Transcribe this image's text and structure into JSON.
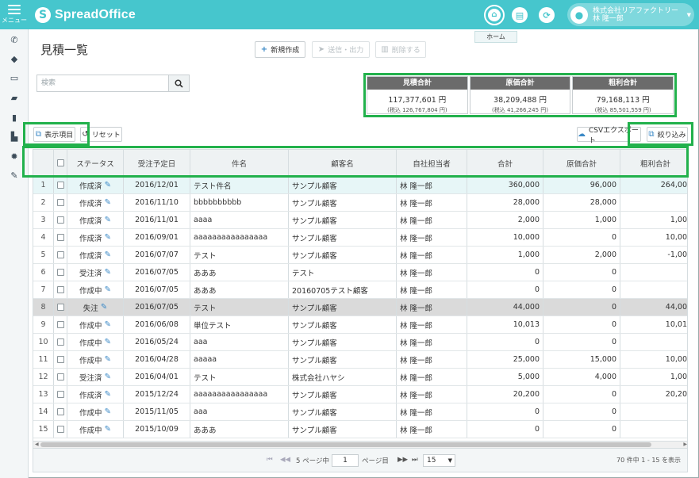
{
  "app": {
    "logo_text": "SpreadOffice",
    "menu_label": "メニュー",
    "home_tooltip": "ホーム",
    "user_company": "株式会社リアファクトリー",
    "user_name": "林 隆一郎"
  },
  "page": {
    "title": "見積一覧"
  },
  "toolbar": {
    "new_label": "新規作成",
    "send_label": "送信・出力",
    "delete_label": "削除する"
  },
  "search": {
    "placeholder": "検索"
  },
  "totals": [
    {
      "label": "見積合計",
      "value": "117,377,601 円",
      "sub": "(税込 126,767,804 円)"
    },
    {
      "label": "原価合計",
      "value": "38,209,488 円",
      "sub": "(税込 41,266,245 円)"
    },
    {
      "label": "粗利合計",
      "value": "79,168,113 円",
      "sub": "(税込 85,501,559 円)"
    }
  ],
  "controls": {
    "display_items_label": "表示項目",
    "reset_label": "リセット",
    "csv_label": "CSVエクスポート",
    "filter_label": "絞り込み"
  },
  "table": {
    "headers": [
      "ステータス",
      "受注予定日",
      "件名",
      "顧客名",
      "自社担当者",
      "合計",
      "原価合計",
      "粗利合計"
    ],
    "rows": [
      {
        "no": "1",
        "status": "作成済",
        "date": "2016/12/01",
        "subject": "テスト件名",
        "customer": "サンプル顧客",
        "staff": "林 隆一郎",
        "total": "360,000",
        "cost": "96,000",
        "profit": "264,00"
      },
      {
        "no": "2",
        "status": "作成済",
        "date": "2016/11/10",
        "subject": "bbbbbbbbbb",
        "customer": "サンプル顧客",
        "staff": "林 隆一郎",
        "total": "28,000",
        "cost": "28,000",
        "profit": ""
      },
      {
        "no": "3",
        "status": "作成済",
        "date": "2016/11/01",
        "subject": "aaaa",
        "customer": "サンプル顧客",
        "staff": "林 隆一郎",
        "total": "2,000",
        "cost": "1,000",
        "profit": "1,00"
      },
      {
        "no": "4",
        "status": "作成済",
        "date": "2016/09/01",
        "subject": "aaaaaaaaaaaaaaaa",
        "customer": "サンプル顧客",
        "staff": "林 隆一郎",
        "total": "10,000",
        "cost": "0",
        "profit": "10,00"
      },
      {
        "no": "5",
        "status": "作成済",
        "date": "2016/07/07",
        "subject": "テスト",
        "customer": "サンプル顧客",
        "staff": "林 隆一郎",
        "total": "1,000",
        "cost": "2,000",
        "profit": "-1,00"
      },
      {
        "no": "6",
        "status": "受注済",
        "date": "2016/07/05",
        "subject": "あああ",
        "customer": "テスト",
        "staff": "林 隆一郎",
        "total": "0",
        "cost": "0",
        "profit": ""
      },
      {
        "no": "7",
        "status": "作成中",
        "date": "2016/07/05",
        "subject": "あああ",
        "customer": "20160705テスト顧客",
        "staff": "林 隆一郎",
        "total": "0",
        "cost": "0",
        "profit": ""
      },
      {
        "no": "8",
        "status": "失注",
        "date": "2016/07/05",
        "subject": "テスト",
        "customer": "サンプル顧客",
        "staff": "林 隆一郎",
        "total": "44,000",
        "cost": "0",
        "profit": "44,00"
      },
      {
        "no": "9",
        "status": "作成中",
        "date": "2016/06/08",
        "subject": "単位テスト",
        "customer": "サンプル顧客",
        "staff": "林 隆一郎",
        "total": "10,013",
        "cost": "0",
        "profit": "10,01"
      },
      {
        "no": "10",
        "status": "作成中",
        "date": "2016/05/24",
        "subject": "aaa",
        "customer": "サンプル顧客",
        "staff": "林 隆一郎",
        "total": "0",
        "cost": "0",
        "profit": ""
      },
      {
        "no": "11",
        "status": "作成中",
        "date": "2016/04/28",
        "subject": "aaaaa",
        "customer": "サンプル顧客",
        "staff": "林 隆一郎",
        "total": "25,000",
        "cost": "15,000",
        "profit": "10,00"
      },
      {
        "no": "12",
        "status": "受注済",
        "date": "2016/04/01",
        "subject": "テスト",
        "customer": "株式会社ハヤシ",
        "staff": "林 隆一郎",
        "total": "5,000",
        "cost": "4,000",
        "profit": "1,00"
      },
      {
        "no": "13",
        "status": "作成済",
        "date": "2015/12/24",
        "subject": "aaaaaaaaaaaaaaaa",
        "customer": "サンプル顧客",
        "staff": "林 隆一郎",
        "total": "20,200",
        "cost": "0",
        "profit": "20,20"
      },
      {
        "no": "14",
        "status": "作成中",
        "date": "2015/11/05",
        "subject": "aaa",
        "customer": "サンプル顧客",
        "staff": "林 隆一郎",
        "total": "0",
        "cost": "0",
        "profit": ""
      },
      {
        "no": "15",
        "status": "作成中",
        "date": "2015/10/09",
        "subject": "あああ",
        "customer": "サンプル顧客",
        "staff": "林 隆一郎",
        "total": "0",
        "cost": "0",
        "profit": ""
      }
    ]
  },
  "pager": {
    "total_pages_label": "5 ページ中",
    "current_page": "1",
    "page_suffix": "ページ目",
    "per_page": "15",
    "summary": "70 件中 1 - 15 を表示"
  },
  "icons": {
    "sidebar": [
      "phone-icon",
      "tag-icon",
      "card-icon",
      "folder-icon",
      "chart-icon",
      "document-icon",
      "gear-icon",
      "wrench-icon"
    ]
  },
  "colors": {
    "accent": "#46c6cd",
    "highlight": "#22b14c"
  }
}
